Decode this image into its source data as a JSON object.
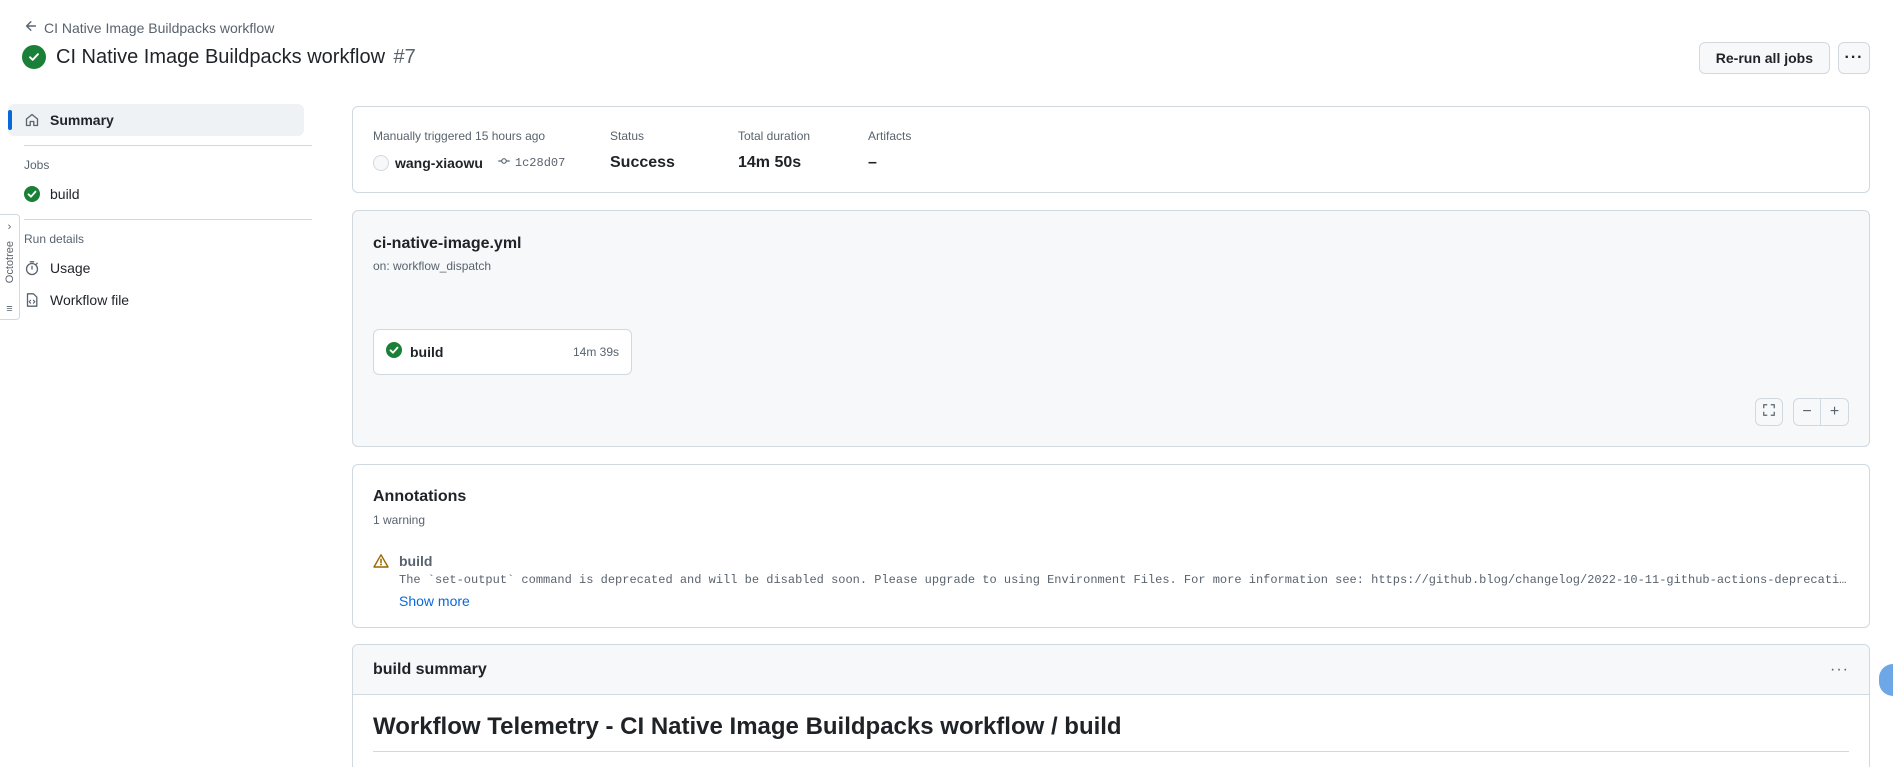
{
  "header": {
    "back_label": "CI Native Image Buildpacks workflow",
    "title": "CI Native Image Buildpacks workflow",
    "run_number": "#7",
    "rerun_label": "Re-run all jobs",
    "more_label": "···"
  },
  "sidebar": {
    "summary_label": "Summary",
    "jobs_heading": "Jobs",
    "jobs": [
      {
        "label": "build",
        "status": "success"
      }
    ],
    "run_details_heading": "Run details",
    "usage_label": "Usage",
    "workflow_file_label": "Workflow file"
  },
  "octotree": {
    "label": "Octotree"
  },
  "summary": {
    "trigger_label": "Manually triggered 15 hours ago",
    "actor": "wang-xiaowu",
    "commit": "1c28d07",
    "status_label": "Status",
    "status_value": "Success",
    "duration_label": "Total duration",
    "duration_value": "14m 50s",
    "artifacts_label": "Artifacts",
    "artifacts_value": "–"
  },
  "graph": {
    "workflow_file": "ci-native-image.yml",
    "trigger": "on: workflow_dispatch",
    "job": {
      "name": "build",
      "duration": "14m 39s"
    },
    "zoom_minus": "−",
    "zoom_plus": "+"
  },
  "annotations": {
    "title": "Annotations",
    "count": "1 warning",
    "items": [
      {
        "job": "build",
        "message": "The `set-output` command is deprecated and will be disabled soon. Please upgrade to using Environment Files. For more information see: https://github.blog/changelog/2022-10-11-github-actions-deprecating-save-state-and-s..."
      }
    ],
    "show_more": "Show more"
  },
  "build_summary": {
    "title": "build summary",
    "menu": "···",
    "heading": "Workflow Telemetry - CI Native Image Buildpacks workflow / build"
  },
  "colors": {
    "success": "#1a7f37",
    "accent": "#0969da",
    "warning": "#9a6700"
  }
}
